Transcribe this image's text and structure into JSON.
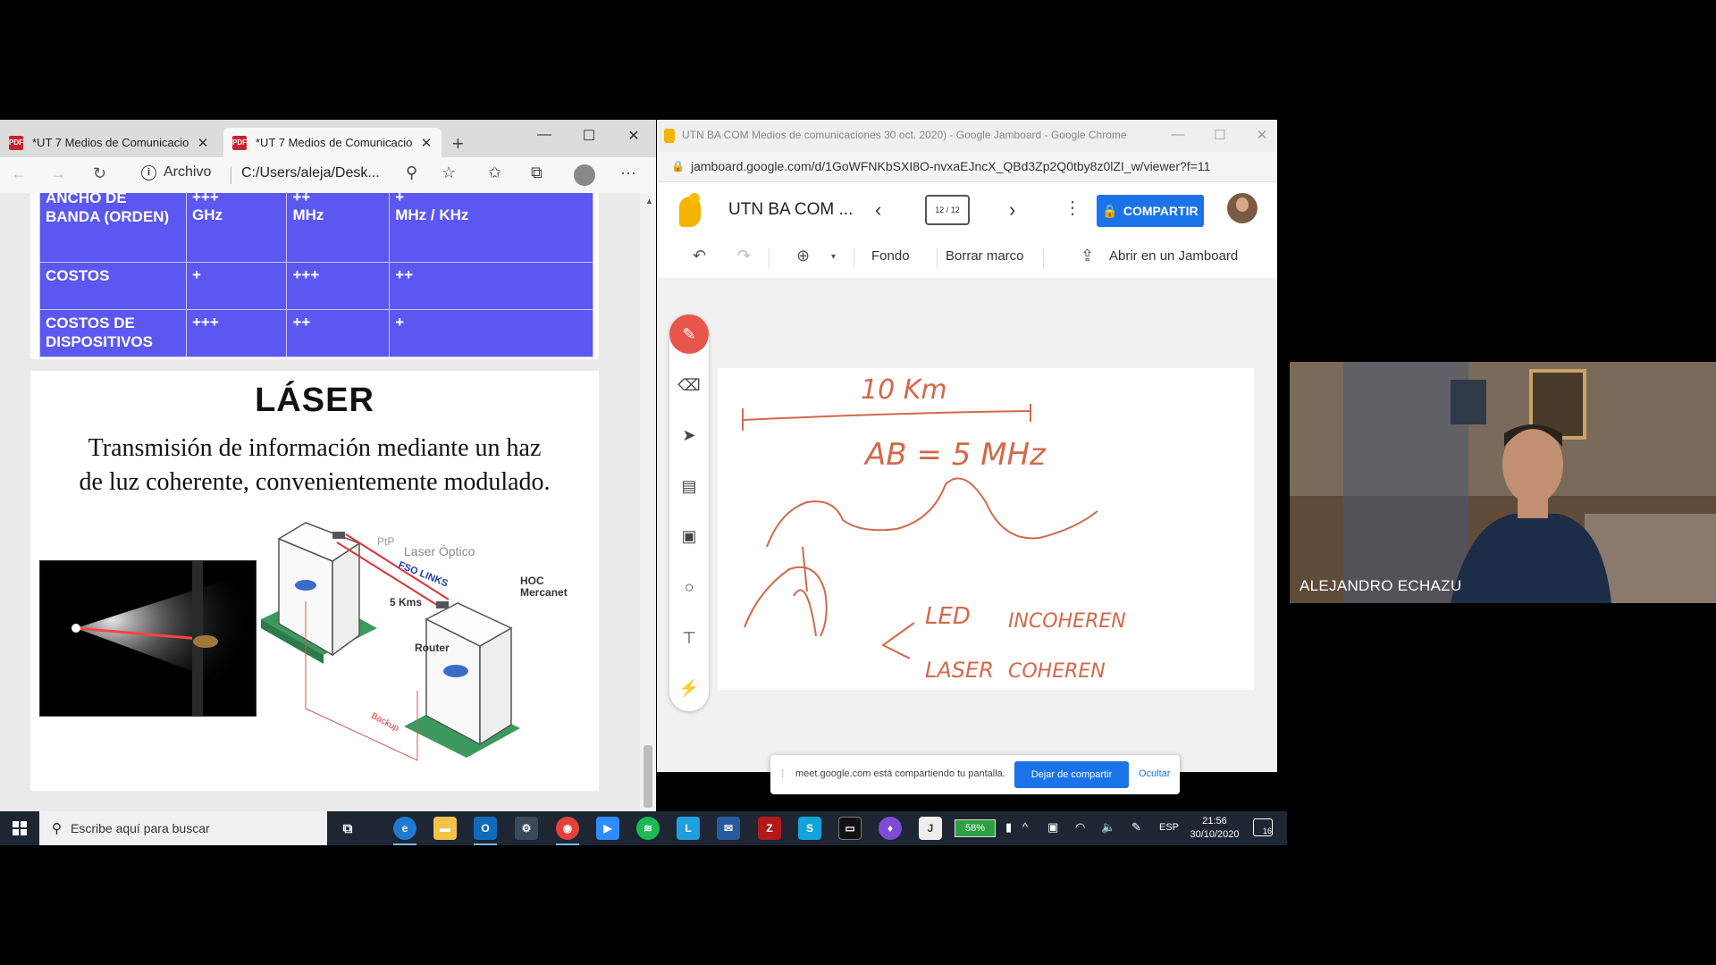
{
  "edge": {
    "tabs": [
      {
        "label": "*UT 7 Medios de Comunicacion",
        "close": "✕"
      },
      {
        "label": "*UT 7 Medios de Comunicacion",
        "close": "✕"
      }
    ],
    "new_tab": "+",
    "window_controls": {
      "minimize": "—",
      "maximize": "☐",
      "close": "✕"
    },
    "address": {
      "info_label": "Archivo",
      "url": "C:/Users/aleja/Desk..."
    },
    "more": "···"
  },
  "pdf": {
    "table": {
      "rows": [
        {
          "header": "ANCHO DE BANDA (ORDEN)",
          "cells": [
            {
              "sym": "+++",
              "unit": "GHz"
            },
            {
              "sym": "++",
              "unit": "MHz"
            },
            {
              "sym": "+",
              "unit": "MHz / KHz"
            }
          ]
        },
        {
          "header": "COSTOS",
          "cells": [
            {
              "sym": "+",
              "unit": ""
            },
            {
              "sym": "+++",
              "unit": ""
            },
            {
              "sym": "++",
              "unit": ""
            }
          ]
        },
        {
          "header": "COSTOS DE DISPOSITIVOS",
          "cells": [
            {
              "sym": "+++",
              "unit": ""
            },
            {
              "sym": "++",
              "unit": ""
            },
            {
              "sym": "+",
              "unit": ""
            }
          ]
        }
      ]
    },
    "slide": {
      "title": "LÁSER",
      "description_line1": "Transmisión de información mediante un haz",
      "description_line2": "de luz coherente, convenientemente modulado.",
      "diagram_labels": {
        "ptp": "PtP",
        "optical": "Laser Óptico",
        "fso": "FSO LINKS",
        "hoc": "HOC",
        "mercanet": "Mercanet",
        "distance": "5 Kms",
        "router": "Router",
        "backup": "Backup"
      }
    }
  },
  "chrome": {
    "title": "UTN BA COM Medios de comunicaciones 30 oct. 2020) - Google Jamboard - Google Chrome",
    "url": "jamboard.google.com/d/1GoWFNKbSXI8O-nvxaEJncX_QBd3Zp2Q0tby8z0lZI_w/viewer?f=11",
    "window_controls": {
      "minimize": "—",
      "maximize": "☐",
      "close": "✕"
    }
  },
  "jamboard": {
    "name": "UTN BA COM ...",
    "frame_counter": "12 / 12",
    "share_label": "COMPARTIR",
    "toolbar": {
      "background": "Fondo",
      "clear_frame": "Borrar marco",
      "open": "Abrir en un Jamboard"
    },
    "icons": [
      "pen-icon",
      "eraser-icon",
      "select-icon",
      "sticky-note-icon",
      "image-icon",
      "circle-icon",
      "text-box-icon",
      "laser-icon"
    ],
    "handwriting": {
      "distance": "10 Km",
      "bandwidth": "AB = 5 MHz",
      "led": "LED",
      "incoherent": "INCOHEREN",
      "laser": "LASER",
      "coherent": "COHEREN"
    }
  },
  "share_notice": {
    "message": "meet.google.com está compartiendo tu pantalla.",
    "stop": "Dejar de compartir",
    "hide": "Ocultar"
  },
  "participant": {
    "name": "ALEJANDRO ECHAZU"
  },
  "taskbar": {
    "search_placeholder": "Escribe aquí para buscar",
    "battery": "58%",
    "language": "ESP",
    "time": "21:56",
    "date": "30/10/2020",
    "notifications": "16"
  },
  "colors": {
    "table_blue": "#5b57f0",
    "ink": "#d2694a",
    "share_blue": "#1a73e8",
    "pen_active": "#e8554a",
    "taskbar": "#1d2632"
  }
}
